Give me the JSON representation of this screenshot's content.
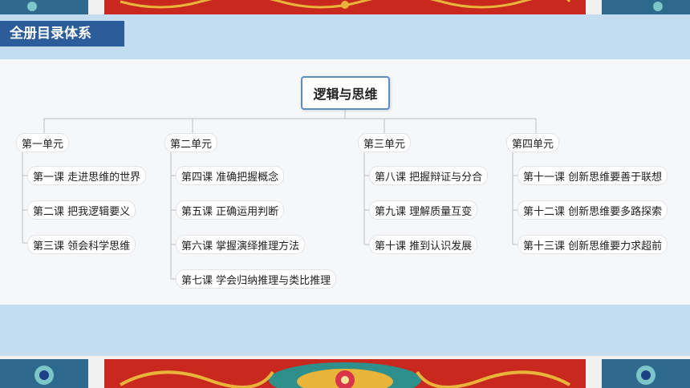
{
  "header": {
    "title": "全册目录体系"
  },
  "mindmap": {
    "root": "逻辑与思维",
    "units": [
      {
        "label": "第一单元",
        "lessons": [
          "第一课 走进思维的世界",
          "第二课 把我逻辑要义",
          "第三课 领会科学思维"
        ]
      },
      {
        "label": "第二单元",
        "lessons": [
          "第四课 准确把握概念",
          "第五课 正确运用判断",
          "第六课 掌握演绎推理方法",
          "第七课 学会归纳推理与类比推理"
        ]
      },
      {
        "label": "第三单元",
        "lessons": [
          "第八课 把握辩证与分合",
          "第九课 理解质量互变",
          "第十课 推到认识发展"
        ]
      },
      {
        "label": "第四单元",
        "lessons": [
          "第十一课 创新思维要善于联想",
          "第十二课 创新思维要多路探索",
          "第十三课 创新思维要力求超前"
        ]
      }
    ]
  }
}
